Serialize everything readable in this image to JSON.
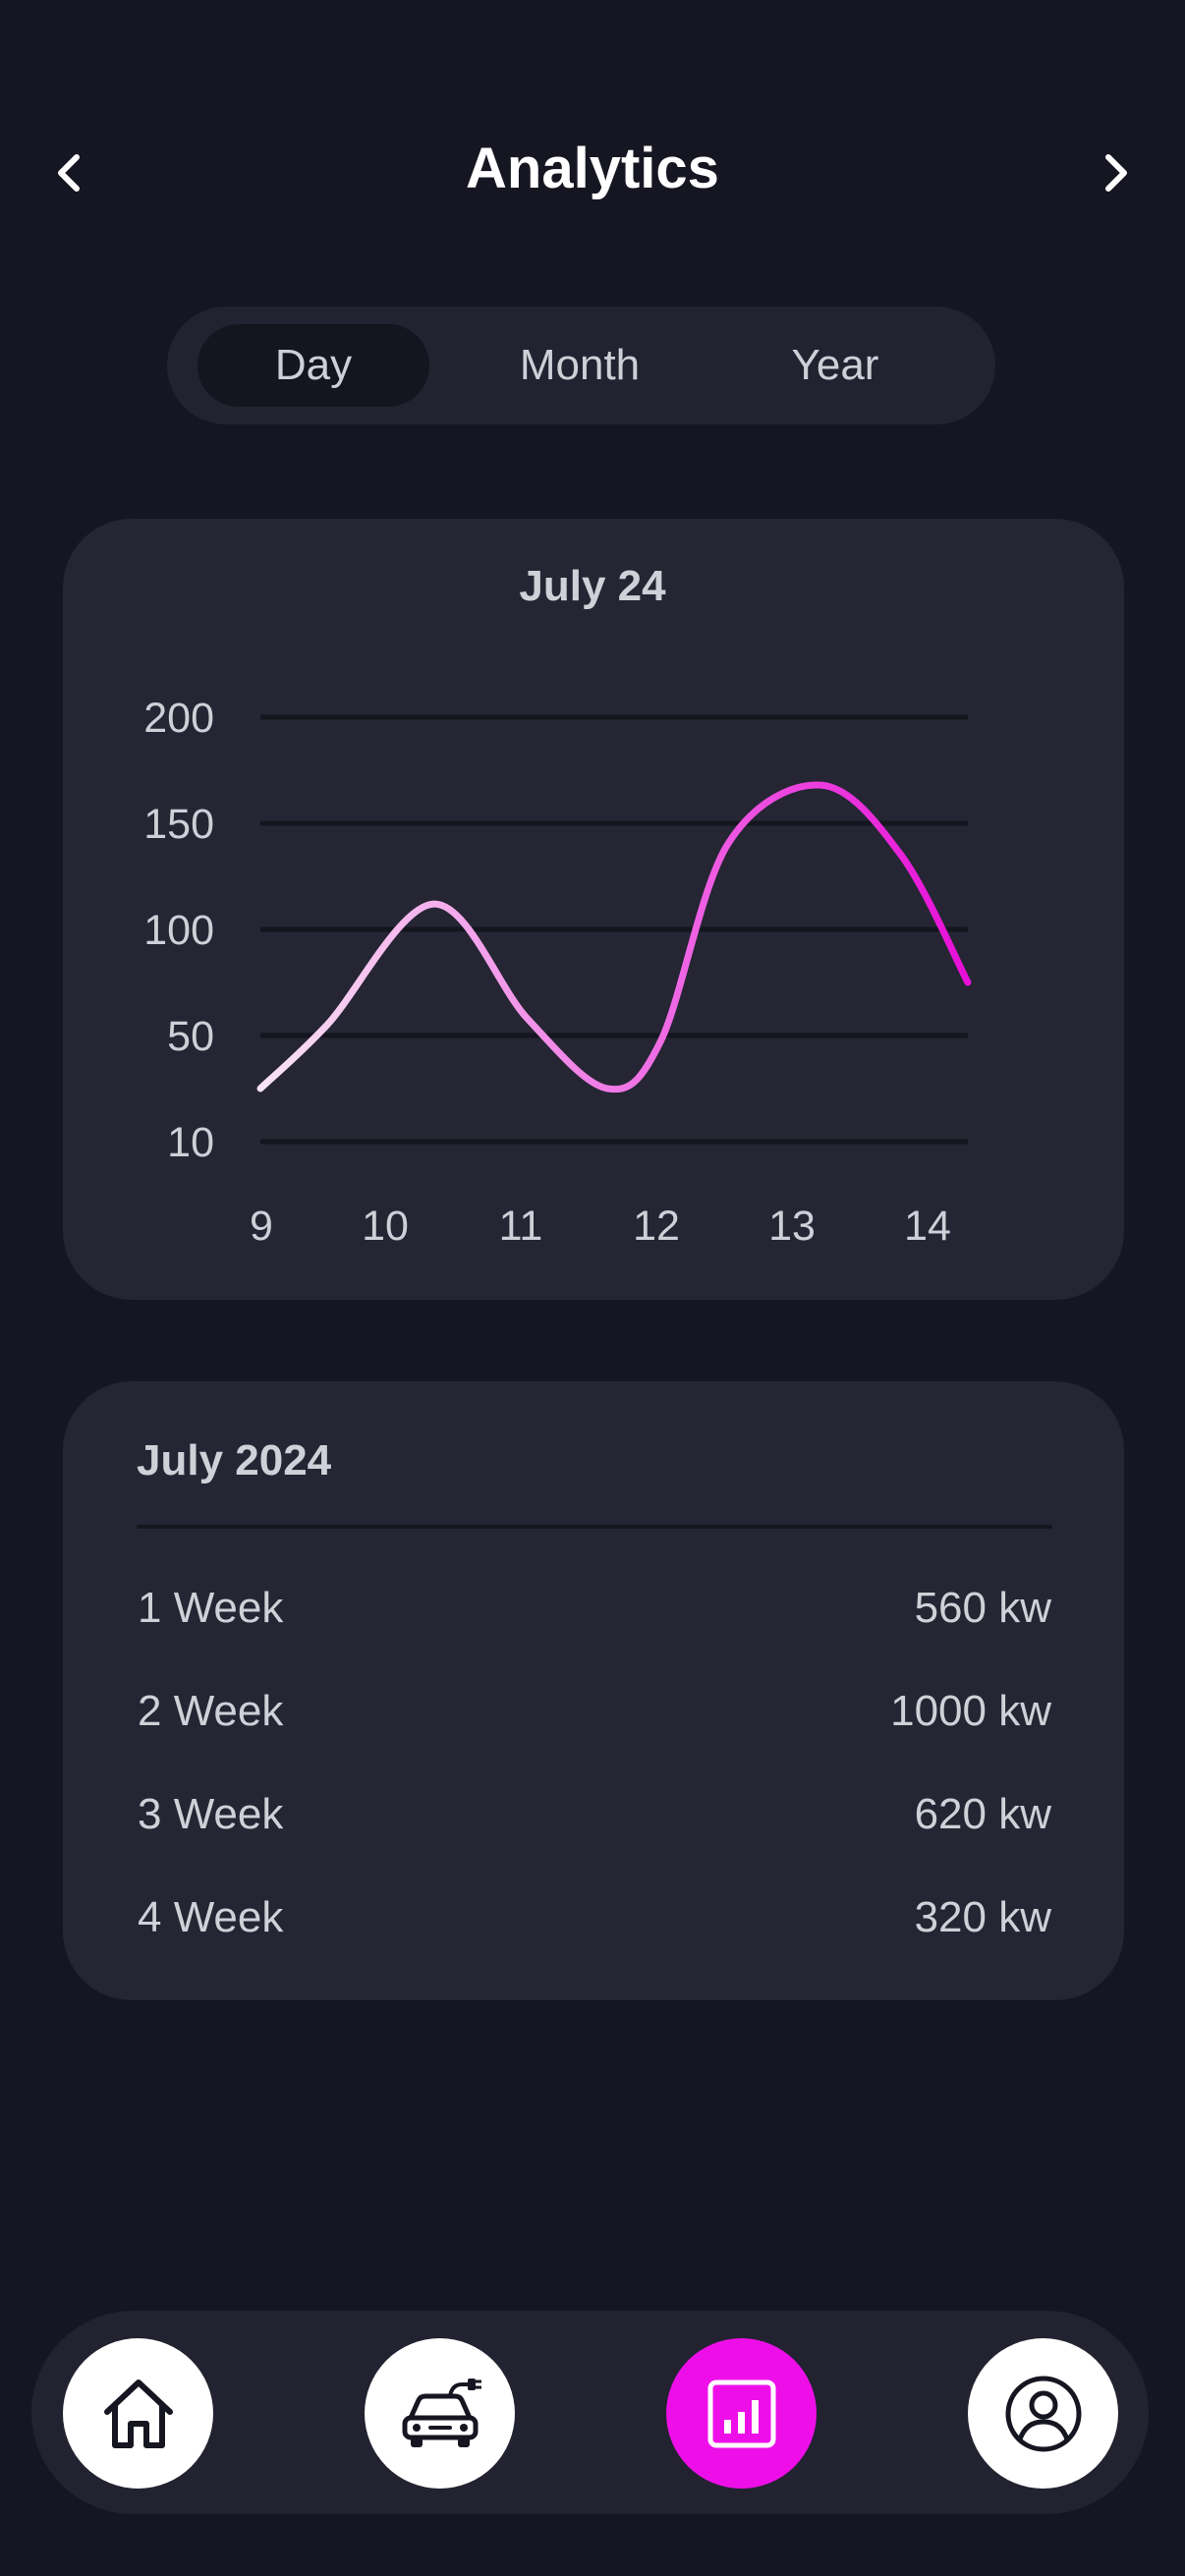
{
  "header": {
    "title": "Analytics",
    "back_icon": "chevron-left-icon",
    "next_icon": "chevron-right-icon"
  },
  "period_tabs": [
    {
      "label": "Day",
      "active": true
    },
    {
      "label": "Month",
      "active": false
    },
    {
      "label": "Year",
      "active": false
    }
  ],
  "chart_card": {
    "title": "July 24"
  },
  "chart_data": {
    "type": "line",
    "title": "July 24",
    "x_ticks": [
      "9",
      "10",
      "11",
      "12",
      "13",
      "14"
    ],
    "y_ticks": [
      "200",
      "150",
      "100",
      "50",
      "10"
    ],
    "x": [
      9,
      9.5,
      10.3,
      11,
      11.6,
      12,
      12.5,
      13.2,
      13.8,
      14.3
    ],
    "y": [
      30,
      55,
      112,
      58,
      30,
      48,
      140,
      168,
      135,
      75
    ],
    "colors": {
      "start": "#f8e4f4",
      "end": "#e80fd8"
    },
    "grid": true
  },
  "summary": {
    "title": "July 2024",
    "rows": [
      {
        "label": "1 Week",
        "value": "560 kw"
      },
      {
        "label": "2 Week",
        "value": "1000 kw"
      },
      {
        "label": "3 Week",
        "value": "620 kw"
      },
      {
        "label": "4 Week",
        "value": "320 kw"
      }
    ]
  },
  "bottom_nav": [
    {
      "icon": "home-icon",
      "active": false
    },
    {
      "icon": "ev-car-icon",
      "active": false
    },
    {
      "icon": "analytics-icon",
      "active": true
    },
    {
      "icon": "profile-icon",
      "active": false
    }
  ],
  "colors": {
    "background": "#161622",
    "card": "#252533",
    "accent": "#ee0fe8"
  }
}
